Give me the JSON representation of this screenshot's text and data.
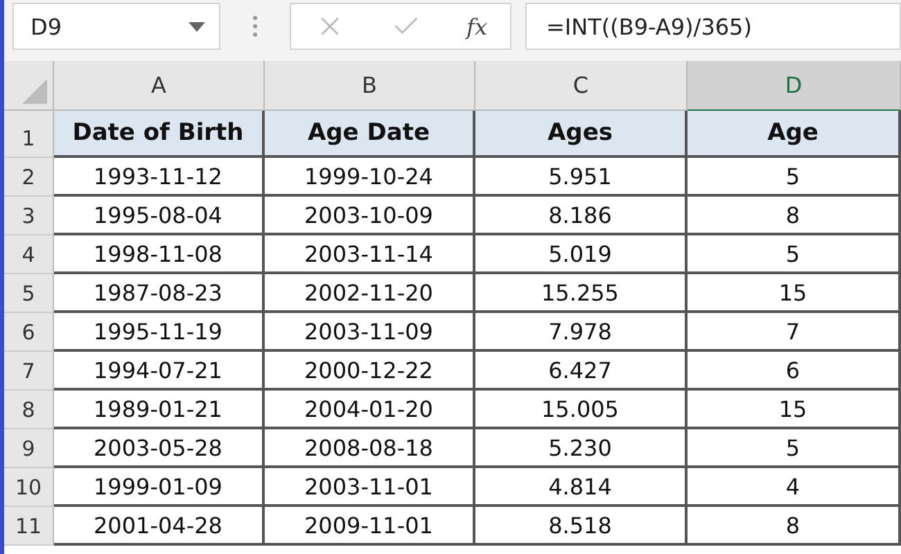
{
  "formula_bar": {
    "name_box": "D9",
    "function_label": "fx",
    "formula": "=INT((B9-A9)/365)"
  },
  "columns": [
    {
      "label": "A",
      "selected": false
    },
    {
      "label": "B",
      "selected": false
    },
    {
      "label": "C",
      "selected": false
    },
    {
      "label": "D",
      "selected": true
    }
  ],
  "rows": [
    {
      "number": "1",
      "kind": "header",
      "cells": [
        "Date of Birth",
        "Age Date",
        "Ages",
        "Age"
      ]
    },
    {
      "number": "2",
      "kind": "data",
      "cells": [
        "1993-11-12",
        "1999-10-24",
        "5.951",
        "5"
      ]
    },
    {
      "number": "3",
      "kind": "data",
      "cells": [
        "1995-08-04",
        "2003-10-09",
        "8.186",
        "8"
      ]
    },
    {
      "number": "4",
      "kind": "data",
      "cells": [
        "1998-11-08",
        "2003-11-14",
        "5.019",
        "5"
      ]
    },
    {
      "number": "5",
      "kind": "data",
      "cells": [
        "1987-08-23",
        "2002-11-20",
        "15.255",
        "15"
      ]
    },
    {
      "number": "6",
      "kind": "data",
      "cells": [
        "1995-11-19",
        "2003-11-09",
        "7.978",
        "7"
      ]
    },
    {
      "number": "7",
      "kind": "data",
      "cells": [
        "1994-07-21",
        "2000-12-22",
        "6.427",
        "6"
      ]
    },
    {
      "number": "8",
      "kind": "data",
      "cells": [
        "1989-01-21",
        "2004-01-20",
        "15.005",
        "15"
      ]
    },
    {
      "number": "9",
      "kind": "data",
      "cells": [
        "2003-05-28",
        "2008-08-18",
        "5.230",
        "5"
      ]
    },
    {
      "number": "10",
      "kind": "data",
      "cells": [
        "1999-01-09",
        "2003-11-01",
        "4.814",
        "4"
      ]
    },
    {
      "number": "11",
      "kind": "data",
      "cells": [
        "2001-04-28",
        "2009-11-01",
        "8.518",
        "8"
      ]
    }
  ]
}
